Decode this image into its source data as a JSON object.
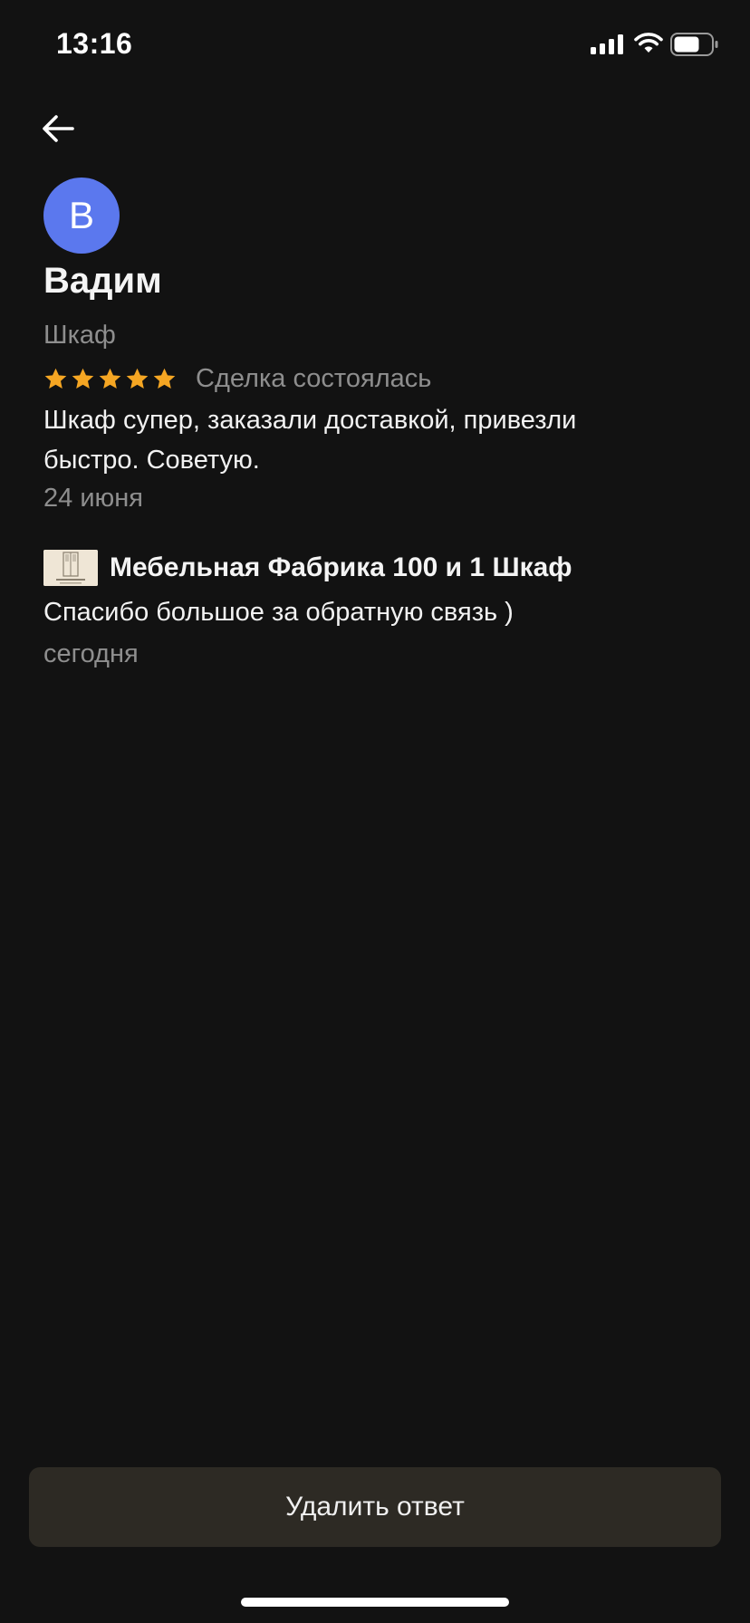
{
  "status_bar": {
    "time": "13:16"
  },
  "review": {
    "avatar_initial": "В",
    "avatar_color": "#5b78ee",
    "reviewer_name": "Вадим",
    "item_name": "Шкаф",
    "rating": 5,
    "max_rating": 5,
    "star_color": "#f5a623",
    "deal_status": "Сделка состоялась",
    "text": "Шкаф супер, заказали доставкой, привезли быстро. Советую.",
    "date": "24 июня"
  },
  "reply": {
    "seller_name": "Мебельная Фабрика 100 и 1 Шкаф",
    "text": "Спасибо большое за обратную связь )",
    "date": "сегодня"
  },
  "actions": {
    "delete_label": "Удалить ответ"
  },
  "icons": {
    "back": "arrow-left-icon",
    "signal": "cellular-signal-icon",
    "wifi": "wifi-icon",
    "battery": "battery-icon",
    "star": "star-icon"
  }
}
